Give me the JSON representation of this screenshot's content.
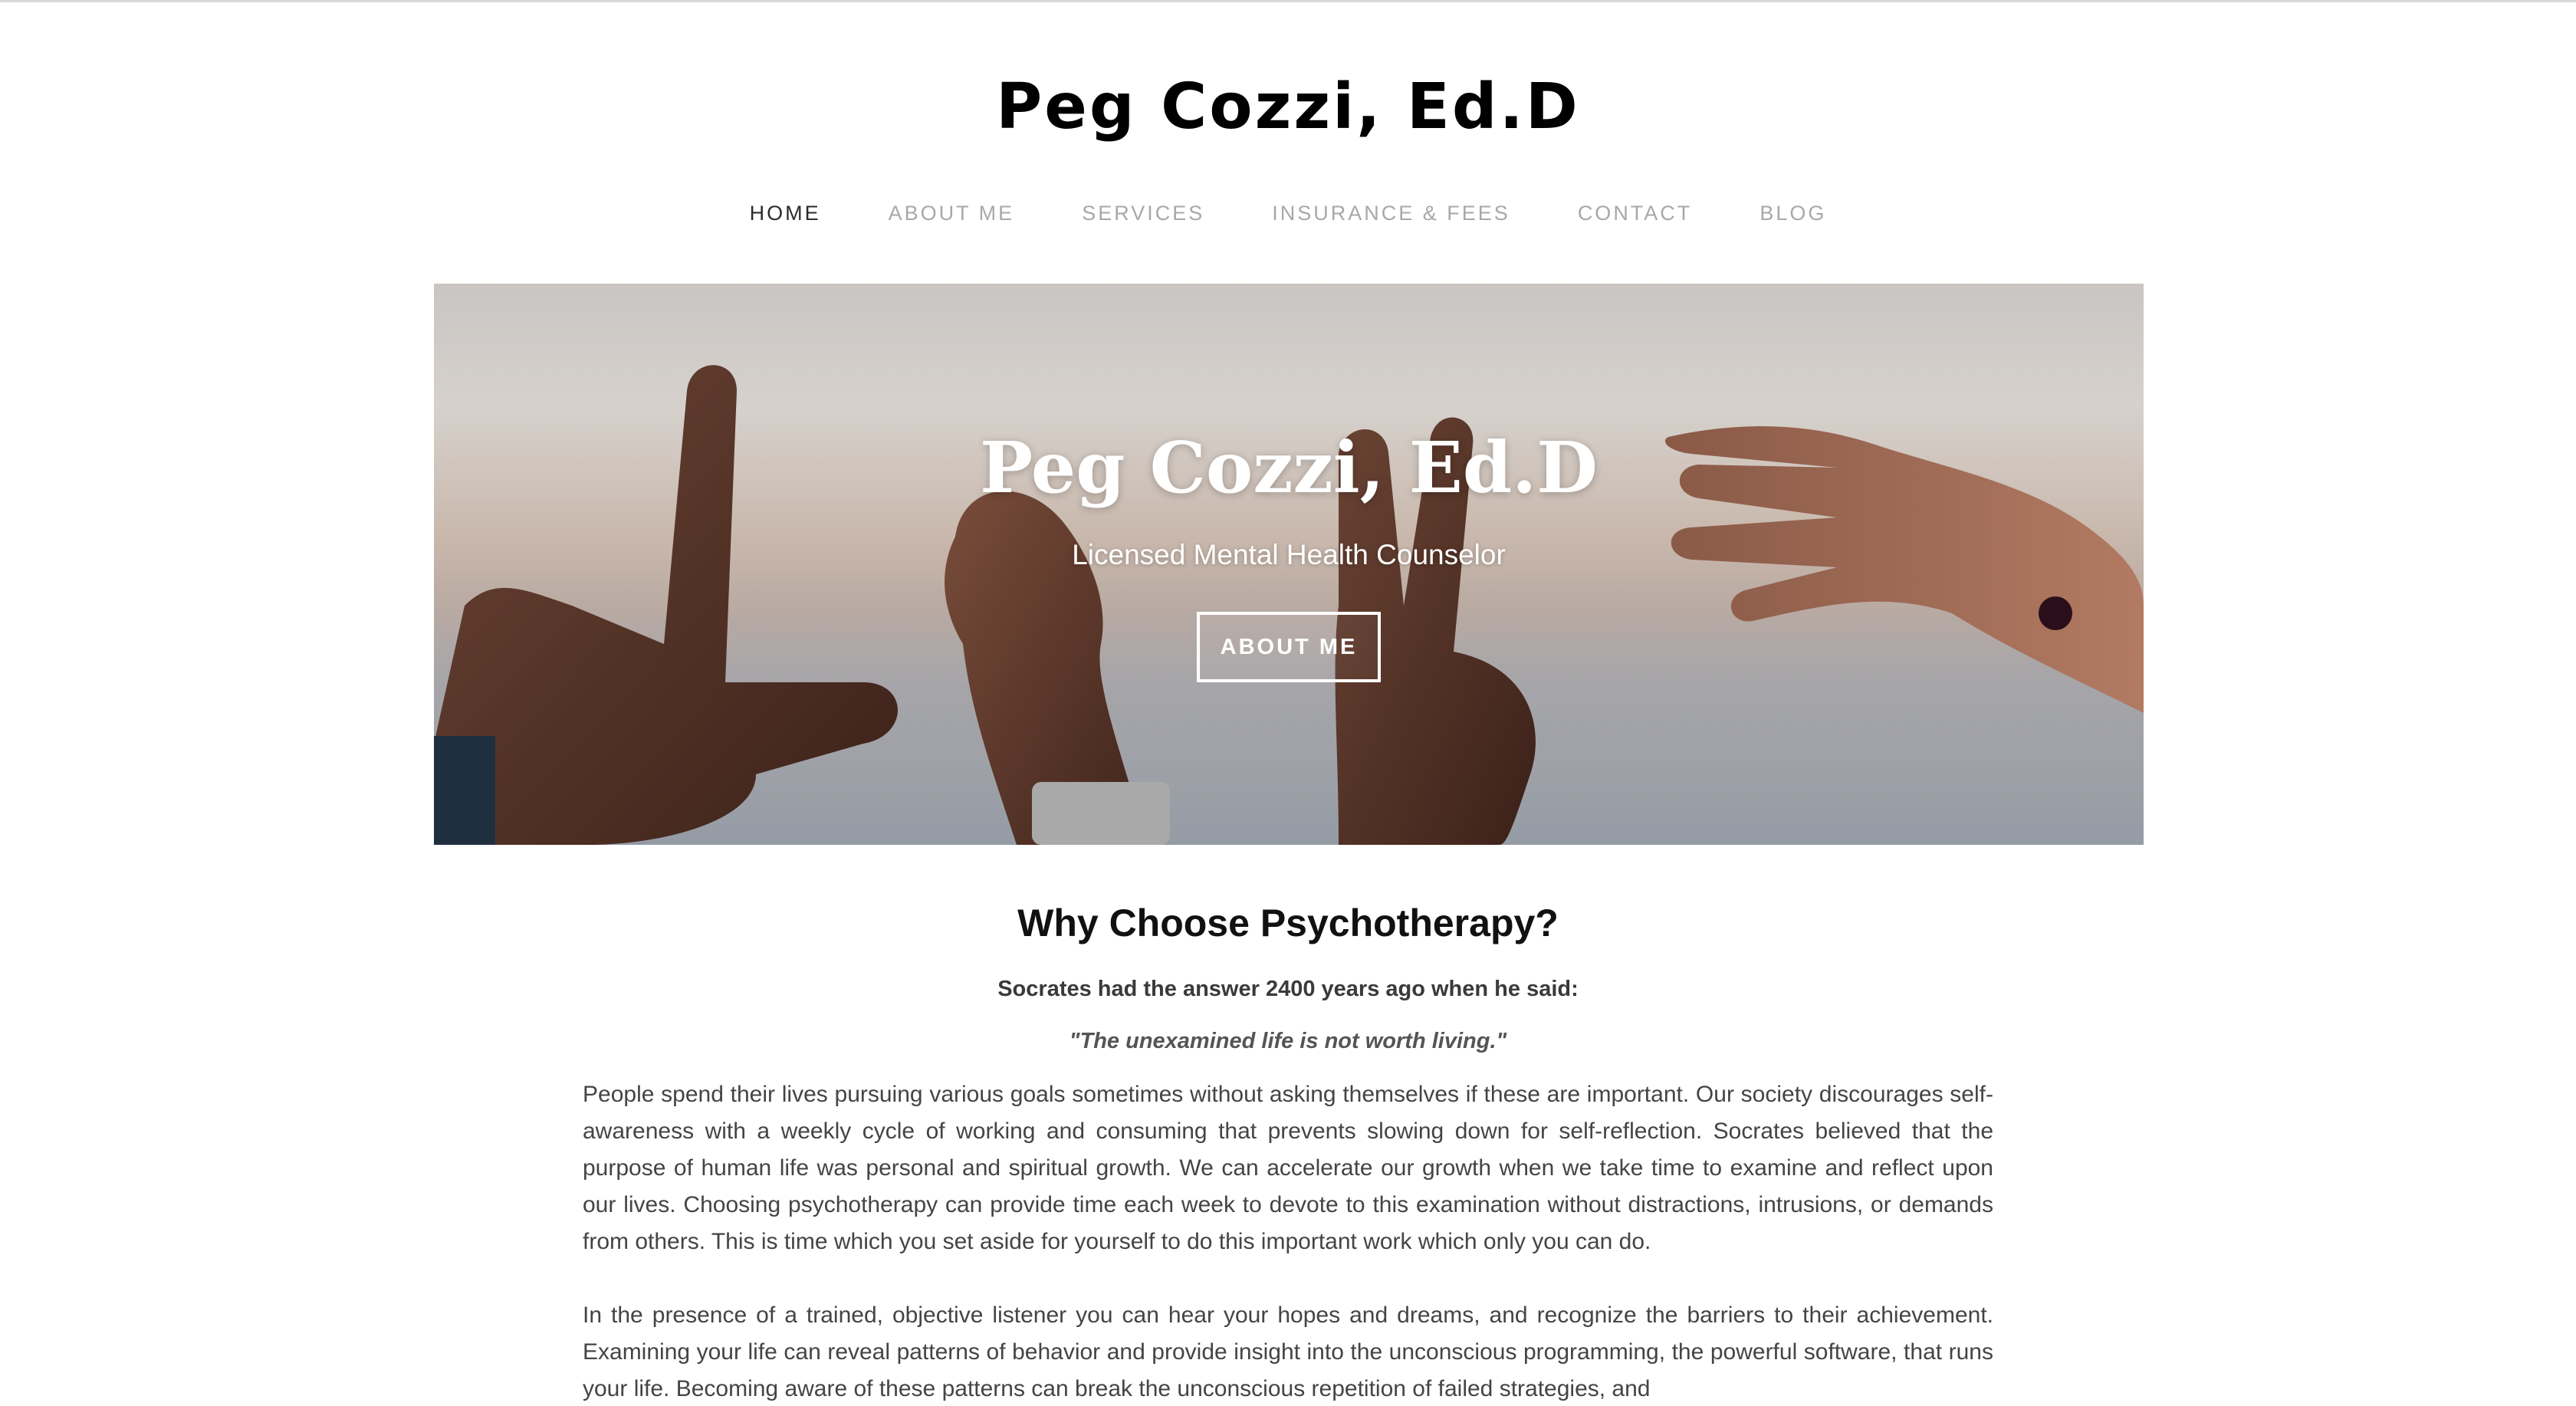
{
  "site": {
    "title": "Peg Cozzi, Ed.D"
  },
  "nav": {
    "items": [
      {
        "label": "HOME",
        "active": true
      },
      {
        "label": "ABOUT ME",
        "active": false
      },
      {
        "label": "SERVICES",
        "active": false
      },
      {
        "label": "INSURANCE & FEES",
        "active": false
      },
      {
        "label": "CONTACT",
        "active": false
      },
      {
        "label": "BLOG",
        "active": false
      }
    ]
  },
  "hero": {
    "title": "Peg Cozzi, Ed.D",
    "subtitle": "Licensed Mental Health Counselor",
    "button_label": "ABOUT ME",
    "image_description": "hands-spelling-love-over-sea"
  },
  "content": {
    "heading": "Why Choose Psychotherapy?",
    "lead": "Socrates had the answer 2400 years ago when he said:",
    "quote": "\"The unexamined life is not worth living.\"",
    "paragraph_1": "People spend their lives pursuing various goals sometimes without asking themselves if these are important.  Our society discourages self-awareness with a weekly cycle of working and consuming that prevents slowing down for self-reflection.  Socrates believed that the purpose of human life was personal and spiritual growth.  We can accelerate our growth when we take time to examine and reflect upon our lives.  Choosing psychotherapy can provide time each week to devote to this examination without distractions, intrusions, or demands from others.  This is time which you set aside for yourself to do this important work which only you can do.",
    "paragraph_2": "In the presence of a trained, objective listener you can hear your hopes and dreams, and recognize the barriers to their achievement. Examining your life can reveal patterns of behavior and provide insight into the unconscious programming, the powerful software, that runs your life.  Becoming aware of these patterns can break the unconscious repetition of failed strategies, and"
  },
  "colors": {
    "title": "#000000",
    "nav_active": "#2b2b2b",
    "nav_inactive": "#a8a8a8",
    "body_text": "#444444",
    "hero_text": "#ffffff"
  }
}
